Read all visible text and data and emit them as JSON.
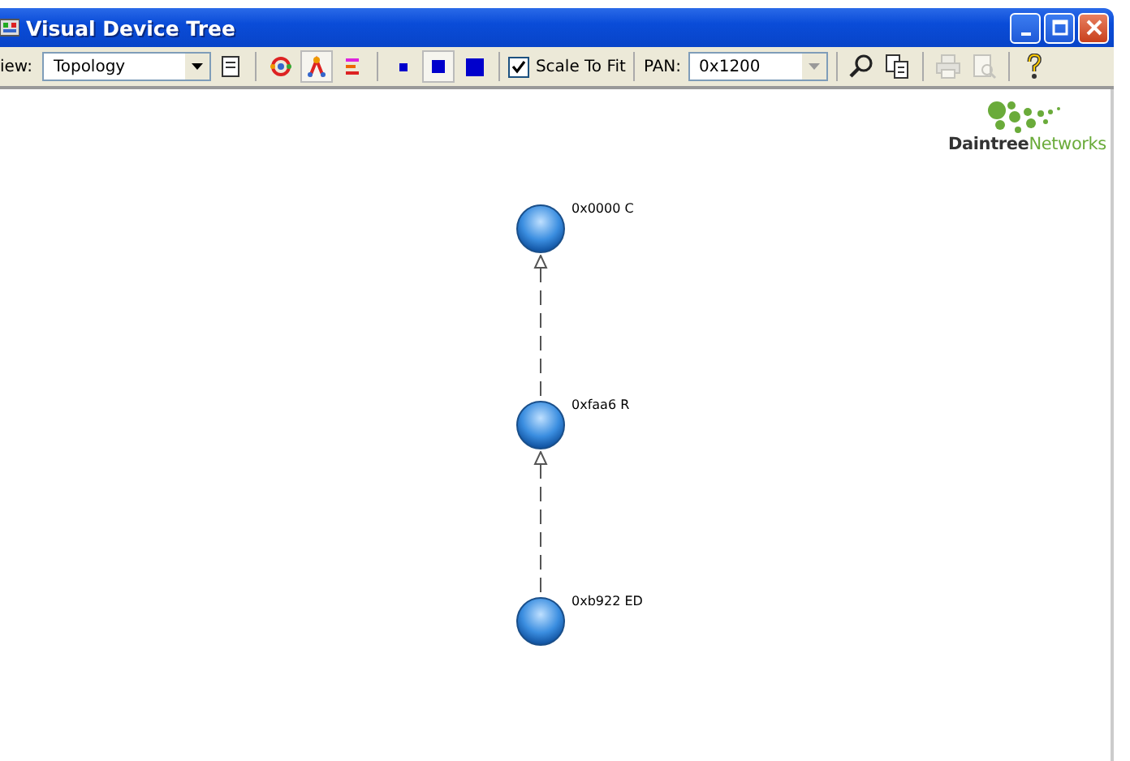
{
  "window": {
    "title": "Visual Device Tree"
  },
  "toolbar": {
    "view_label": "iew:",
    "view_value": "Topology",
    "tools_a": [
      {
        "kind": "document",
        "pressed": false,
        "disabled": false
      },
      {
        "kind": "sep"
      },
      {
        "kind": "ring",
        "pressed": false,
        "disabled": false
      },
      {
        "kind": "tree",
        "pressed": true,
        "disabled": false
      },
      {
        "kind": "bars",
        "pressed": false,
        "disabled": false
      },
      {
        "kind": "sep"
      },
      {
        "kind": "small-square",
        "pressed": false,
        "disabled": false
      },
      {
        "kind": "medium-square",
        "pressed": true,
        "disabled": false
      },
      {
        "kind": "large-square",
        "pressed": false,
        "disabled": false
      },
      {
        "kind": "sep"
      }
    ],
    "scale_to_fit": {
      "label": "Scale To Fit",
      "checked": true
    },
    "pan_label": "PAN:",
    "pan_value": "0x1200",
    "tools_b": [
      {
        "kind": "search",
        "pressed": false,
        "disabled": false
      },
      {
        "kind": "copy",
        "pressed": false,
        "disabled": false
      },
      {
        "kind": "sep"
      },
      {
        "kind": "print",
        "pressed": false,
        "disabled": true
      },
      {
        "kind": "preview",
        "pressed": false,
        "disabled": true
      },
      {
        "kind": "sep"
      },
      {
        "kind": "help",
        "pressed": false,
        "disabled": false
      }
    ]
  },
  "logo": {
    "part_1": "Daintree",
    "part_2": "Networks"
  },
  "nodes": [
    {
      "label": "0x0000 C"
    },
    {
      "label": "0xfaa6 R"
    },
    {
      "label": "0xb922 ED"
    }
  ]
}
